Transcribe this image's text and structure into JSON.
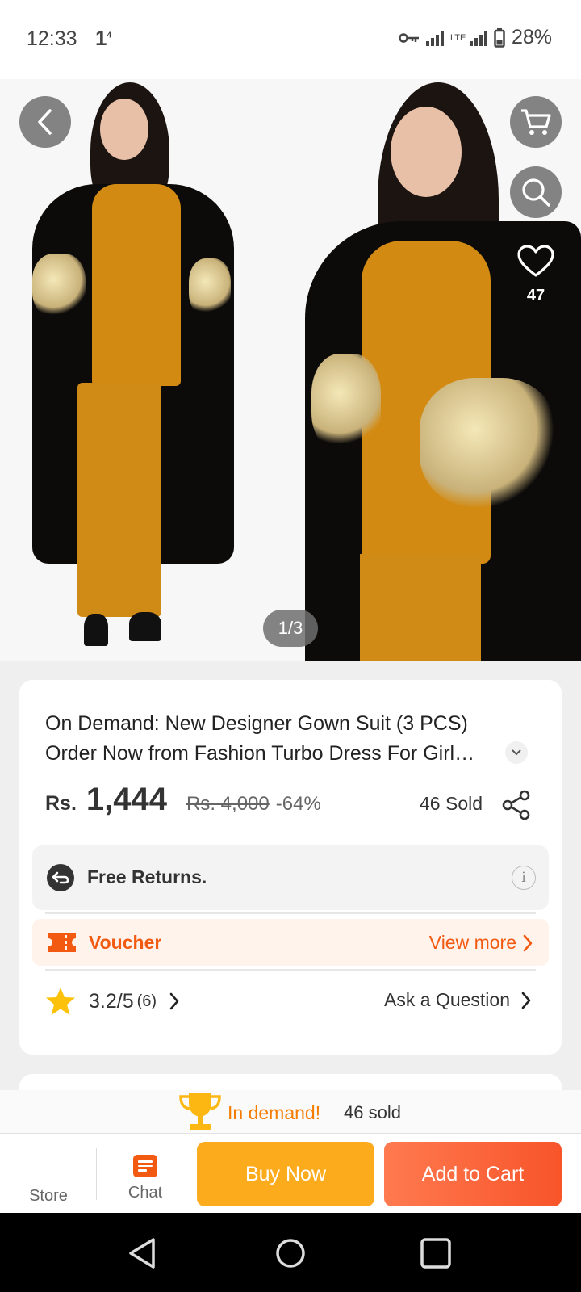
{
  "status_bar": {
    "time": "12:33",
    "notification": "1",
    "notification_sup": "4",
    "battery": "28%",
    "network": "LTE"
  },
  "gallery": {
    "page_indicator": "1/3",
    "favorites_count": "47"
  },
  "product": {
    "title_line1": "On Demand: New Designer Gown Suit (3 PCS)",
    "title_line2": "Order Now from Fashion Turbo Dress For Girl…",
    "currency": "Rs.",
    "price": "1,444",
    "original_price": "Rs. 4,000",
    "discount": "-64%",
    "sold": "46 Sold"
  },
  "returns": {
    "label": "Free Returns.",
    "info_icon": "i"
  },
  "voucher": {
    "label": "Voucher",
    "view_more": "View more"
  },
  "rating": {
    "value": "3.2/5",
    "count": "(6)",
    "ask_question": "Ask a Question"
  },
  "demand": {
    "label": "In demand!",
    "sold": "46 sold"
  },
  "action_bar": {
    "store": "Store",
    "chat": "Chat",
    "buy_now": "Buy Now",
    "add_to_cart": "Add to Cart"
  },
  "colors": {
    "accent": "#f25a12",
    "buy_now": "#fcab1c",
    "add_to_cart": "#f8542a",
    "demand": "#f57c00",
    "star": "#fcc20b"
  }
}
